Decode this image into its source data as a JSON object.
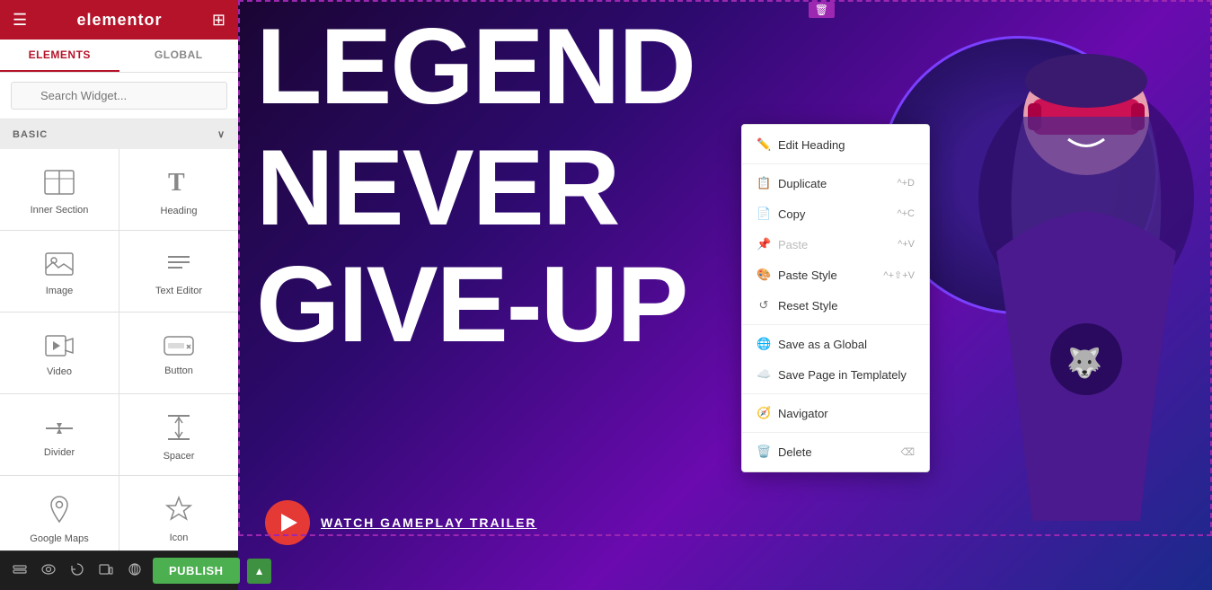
{
  "header": {
    "logo": "elementor",
    "hamburger_icon": "☰",
    "grid_icon": "⊞"
  },
  "tabs": {
    "elements_label": "ELEMENTS",
    "global_label": "GLOBAL",
    "active": "elements"
  },
  "search": {
    "placeholder": "Search Widget..."
  },
  "section_basic": {
    "label": "BASIC",
    "collapse_icon": "∨"
  },
  "widgets": [
    {
      "id": "inner-section",
      "label": "Inner Section",
      "icon": "inner-section-icon"
    },
    {
      "id": "heading",
      "label": "Heading",
      "icon": "heading-icon"
    },
    {
      "id": "image",
      "label": "Image",
      "icon": "image-icon"
    },
    {
      "id": "text-editor",
      "label": "Text Editor",
      "icon": "text-editor-icon"
    },
    {
      "id": "video",
      "label": "Video",
      "icon": "video-icon"
    },
    {
      "id": "button",
      "label": "Button",
      "icon": "button-icon"
    },
    {
      "id": "divider",
      "label": "Divider",
      "icon": "divider-icon"
    },
    {
      "id": "spacer",
      "label": "Spacer",
      "icon": "spacer-icon"
    },
    {
      "id": "google-maps",
      "label": "Google Maps",
      "icon": "maps-icon"
    },
    {
      "id": "icon",
      "label": "Icon",
      "icon": "icon-icon"
    }
  ],
  "bottom_toolbar": {
    "icons": [
      "layers-icon",
      "eye-icon",
      "history-icon",
      "device-icon",
      "preview-icon"
    ],
    "publish_label": "PUBLISH"
  },
  "context_menu": {
    "items": [
      {
        "id": "edit-heading",
        "label": "Edit Heading",
        "shortcut": "",
        "icon": "pencil",
        "disabled": false,
        "separator_after": true
      },
      {
        "id": "duplicate",
        "label": "Duplicate",
        "shortcut": "^+D",
        "icon": "copy-doc",
        "disabled": false,
        "separator_after": false
      },
      {
        "id": "copy",
        "label": "Copy",
        "shortcut": "^+C",
        "icon": "copy",
        "disabled": false,
        "separator_after": false
      },
      {
        "id": "paste",
        "label": "Paste",
        "shortcut": "^+V",
        "icon": "paste",
        "disabled": true,
        "separator_after": false
      },
      {
        "id": "paste-style",
        "label": "Paste Style",
        "shortcut": "^+⇧+V",
        "icon": "paste-style",
        "disabled": false,
        "separator_after": false
      },
      {
        "id": "reset-style",
        "label": "Reset Style",
        "shortcut": "",
        "icon": "reset",
        "disabled": false,
        "separator_after": true
      },
      {
        "id": "save-global",
        "label": "Save as a Global",
        "shortcut": "",
        "icon": "globe",
        "disabled": false,
        "separator_after": false
      },
      {
        "id": "save-page",
        "label": "Save Page in Templately",
        "shortcut": "",
        "icon": "cloud",
        "disabled": false,
        "separator_after": true
      },
      {
        "id": "navigator",
        "label": "Navigator",
        "shortcut": "",
        "icon": "nav",
        "disabled": false,
        "separator_after": true
      },
      {
        "id": "delete",
        "label": "Delete",
        "shortcut": "⌫",
        "icon": "trash",
        "disabled": false,
        "separator_after": false
      }
    ]
  },
  "canvas": {
    "hero_line1": "LEGEND",
    "hero_line2": "NEVER",
    "hero_line3": "GIVE-UP",
    "watch_label": "WATCH GAMEPLAY TRAILER"
  }
}
